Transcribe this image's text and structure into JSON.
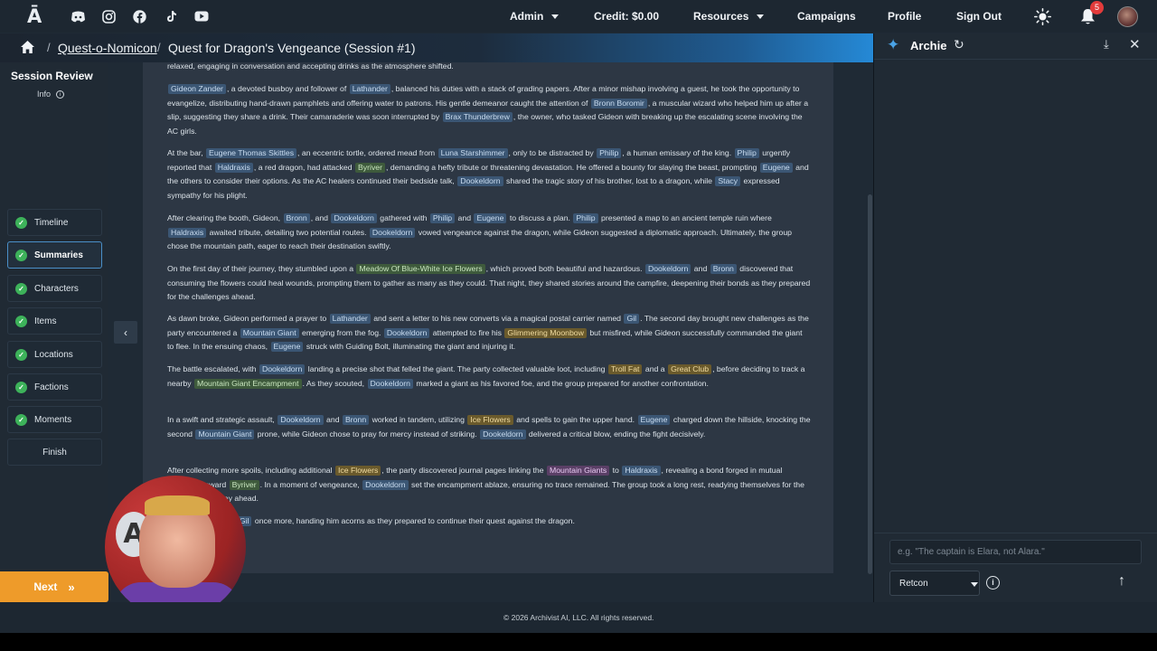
{
  "topbar": {
    "logo": "Ā",
    "social": [
      "discord-icon",
      "instagram-icon",
      "facebook-icon",
      "tiktok-icon",
      "youtube-icon"
    ],
    "nav": {
      "admin": "Admin",
      "credit": "Credit: $0.00",
      "resources": "Resources",
      "campaigns": "Campaigns",
      "profile": "Profile",
      "signout": "Sign Out"
    },
    "notifications": "5"
  },
  "breadcrumb": {
    "campaign": "Quest-o-Nomicon",
    "session": "Quest for Dragon's Vengeance (Session #1)"
  },
  "sidebar": {
    "title": "Session Review",
    "info": "Info",
    "steps": [
      {
        "label": "Timeline",
        "done": true
      },
      {
        "label": "Summaries",
        "done": true,
        "active": true
      },
      {
        "label": "Characters",
        "done": true
      },
      {
        "label": "Items",
        "done": true
      },
      {
        "label": "Locations",
        "done": true
      },
      {
        "label": "Factions",
        "done": true
      },
      {
        "label": "Moments",
        "done": true
      },
      {
        "label": "Finish",
        "done": false
      }
    ],
    "next": "Next"
  },
  "summary": {
    "p0": [
      [
        "t",
        "relaxed, engaging in conversation and accepting drinks as the atmosphere shifted."
      ]
    ],
    "p1": [
      [
        "p",
        "Gideon Zander"
      ],
      [
        "t",
        ", a devoted busboy and follower of "
      ],
      [
        "p",
        "Lathander"
      ],
      [
        "t",
        ", balanced his duties with a stack of grading papers. After a minor mishap involving a guest, he took the opportunity to evangelize, distributing hand-drawn pamphlets and offering water to patrons. His gentle demeanor caught the attention of "
      ],
      [
        "p",
        "Bronn Boromir"
      ],
      [
        "t",
        ", a muscular wizard who helped him up after a slip, suggesting they share a drink. Their camaraderie was soon interrupted by "
      ],
      [
        "p",
        "Brax Thunderbrew"
      ],
      [
        "t",
        ", the owner, who tasked Gideon with breaking up the escalating scene involving the AC girls."
      ]
    ],
    "p2": [
      [
        "t",
        "At the bar, "
      ],
      [
        "p",
        "Eugene Thomas Skittles"
      ],
      [
        "t",
        ", an eccentric tortle, ordered mead from "
      ],
      [
        "p",
        "Luna Starshimmer"
      ],
      [
        "t",
        ", only to be distracted by "
      ],
      [
        "p",
        "Philip"
      ],
      [
        "t",
        ", a human emissary of the king. "
      ],
      [
        "p",
        "Philip"
      ],
      [
        "t",
        " urgently reported that "
      ],
      [
        "p",
        "Haldraxis"
      ],
      [
        "t",
        ", a red dragon, had attacked "
      ],
      [
        "l",
        "Byriver"
      ],
      [
        "t",
        ", demanding a hefty tribute or threatening devastation. He offered a bounty for slaying the beast, prompting "
      ],
      [
        "p",
        "Eugene"
      ],
      [
        "t",
        " and the others to consider their options. As the AC healers continued their bedside talk, "
      ],
      [
        "p",
        "Dookeldorn"
      ],
      [
        "t",
        " shared the tragic story of his brother, lost to a dragon, while "
      ],
      [
        "p",
        "Stacy"
      ],
      [
        "t",
        " expressed sympathy for his plight."
      ]
    ],
    "p3": [
      [
        "t",
        "After clearing the booth, Gideon, "
      ],
      [
        "p",
        "Bronn"
      ],
      [
        "t",
        ", and "
      ],
      [
        "p",
        "Dookeldorn"
      ],
      [
        "t",
        " gathered with "
      ],
      [
        "p",
        "Philip"
      ],
      [
        "t",
        " and "
      ],
      [
        "p",
        "Eugene"
      ],
      [
        "t",
        " to discuss a plan. "
      ],
      [
        "p",
        "Philip"
      ],
      [
        "t",
        " presented a map to an ancient temple ruin where "
      ],
      [
        "p",
        "Haldraxis"
      ],
      [
        "t",
        " awaited tribute, detailing two potential routes. "
      ],
      [
        "p",
        "Dookeldorn"
      ],
      [
        "t",
        " vowed vengeance against the dragon, while Gideon suggested a diplomatic approach. Ultimately, the group chose the mountain path, eager to reach their destination swiftly."
      ]
    ],
    "p4": [
      [
        "t",
        "On the first day of their journey, they stumbled upon a "
      ],
      [
        "l",
        "Meadow Of Blue-White Ice Flowers"
      ],
      [
        "t",
        ", which proved both beautiful and hazardous. "
      ],
      [
        "p",
        "Dookeldorn"
      ],
      [
        "t",
        " and "
      ],
      [
        "p",
        "Bronn"
      ],
      [
        "t",
        " discovered that consuming the flowers could heal wounds, prompting them to gather as many as they could. That night, they shared stories around the campfire, deepening their bonds as they prepared for the challenges ahead."
      ]
    ],
    "p5": [
      [
        "t",
        "As dawn broke, Gideon performed a prayer to "
      ],
      [
        "p",
        "Lathander"
      ],
      [
        "t",
        " and sent a letter to his new converts via a magical postal carrier named "
      ],
      [
        "p",
        "Gil"
      ],
      [
        "t",
        ". The second day brought new challenges as the party encountered a "
      ],
      [
        "p",
        "Mountain Giant"
      ],
      [
        "t",
        " emerging from the fog. "
      ],
      [
        "p",
        "Dookeldorn"
      ],
      [
        "t",
        " attempted to fire his "
      ],
      [
        "i",
        "Glimmering Moonbow"
      ],
      [
        "t",
        " but misfired, while Gideon successfully commanded the giant to flee. In the ensuing chaos, "
      ],
      [
        "p",
        "Eugene"
      ],
      [
        "t",
        " struck with Guiding Bolt, illuminating the giant and injuring it."
      ]
    ],
    "p6": [
      [
        "t",
        "The battle escalated, with "
      ],
      [
        "p",
        "Dookeldorn"
      ],
      [
        "t",
        " landing a precise shot that felled the giant. The party collected valuable loot, including "
      ],
      [
        "i",
        "Troll Fat"
      ],
      [
        "t",
        " and a "
      ],
      [
        "i",
        "Great Club"
      ],
      [
        "t",
        ", before deciding to track a nearby "
      ],
      [
        "l",
        "Mountain Giant Encampment"
      ],
      [
        "t",
        ". As they scouted, "
      ],
      [
        "p",
        "Dookeldorn"
      ],
      [
        "t",
        " marked a giant as his favored foe, and the group prepared for another confrontation."
      ]
    ],
    "p7": [
      [
        "t",
        "In a swift and strategic assault, "
      ],
      [
        "p",
        "Dookeldorn"
      ],
      [
        "t",
        " and "
      ],
      [
        "p",
        "Bronn"
      ],
      [
        "t",
        " worked in tandem, utilizing "
      ],
      [
        "i",
        "Ice Flowers"
      ],
      [
        "t",
        " and spells to gain the upper hand. "
      ],
      [
        "p",
        "Eugene"
      ],
      [
        "t",
        " charged down the hillside, knocking the second "
      ],
      [
        "p",
        "Mountain Giant"
      ],
      [
        "t",
        " prone, while Gideon chose to pray for mercy instead of striking. "
      ],
      [
        "p",
        "Dookeldorn"
      ],
      [
        "t",
        " delivered a critical blow, ending the fight decisively."
      ]
    ],
    "p8": [
      [
        "t",
        "After collecting more spoils, including additional "
      ],
      [
        "i",
        "Ice Flowers"
      ],
      [
        "t",
        ", the party discovered journal pages linking the "
      ],
      [
        "f",
        "Mountain Giants"
      ],
      [
        "t",
        " to "
      ],
      [
        "p",
        "Haldraxis"
      ],
      [
        "t",
        ", revealing a bond forged in mutual animosity toward "
      ],
      [
        "l",
        "Byriver"
      ],
      [
        "t",
        ". In a moment of vengeance, "
      ],
      [
        "p",
        "Dookeldorn"
      ],
      [
        "t",
        " set the encampment ablaze, ensuring no trace remained. The group took a long rest, readying themselves for the challenges that lay ahead."
      ]
    ],
    "p9": [
      [
        "t",
        "Gideon summoned "
      ],
      [
        "p",
        "Gil"
      ],
      [
        "t",
        " once more, handing him acorns as they prepared to continue their quest against the dragon."
      ]
    ]
  },
  "archie": {
    "title": "Archie",
    "placeholder": "e.g. \"The captain is Elara, not Alara.\"",
    "mode": "Retcon"
  },
  "footer": "© 2026 Archivist AI, LLC. All rights reserved."
}
